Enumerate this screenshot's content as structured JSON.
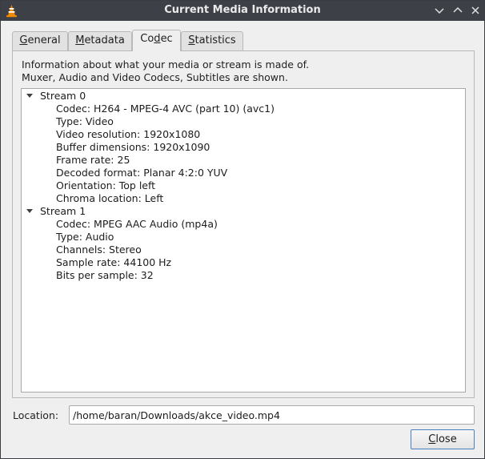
{
  "window": {
    "title": "Current Media Information"
  },
  "titlebar": {
    "icons": [
      "vlc-cone-icon",
      "minimize-icon",
      "maximize-icon",
      "close-icon"
    ]
  },
  "tabs": [
    {
      "label_pre": "",
      "label_ul": "G",
      "label_post": "eneral",
      "active": false
    },
    {
      "label_pre": "",
      "label_ul": "M",
      "label_post": "etadata",
      "active": false
    },
    {
      "label_pre": "Co",
      "label_ul": "d",
      "label_post": "ec",
      "active": true
    },
    {
      "label_pre": "",
      "label_ul": "S",
      "label_post": "tatistics",
      "active": false
    }
  ],
  "codec": {
    "description_line1": "Information about what your media or stream is made of.",
    "description_line2": "Muxer, Audio and Video Codecs, Subtitles are shown.",
    "streams": [
      {
        "label": "Stream 0",
        "properties": [
          "Codec: H264 - MPEG-4 AVC (part 10) (avc1)",
          "Type: Video",
          "Video resolution: 1920x1080",
          "Buffer dimensions: 1920x1090",
          "Frame rate: 25",
          "Decoded format: Planar 4:2:0 YUV",
          "Orientation: Top left",
          "Chroma location: Left"
        ]
      },
      {
        "label": "Stream 1",
        "properties": [
          "Codec: MPEG AAC Audio (mp4a)",
          "Type: Audio",
          "Channels: Stereo",
          "Sample rate: 44100 Hz",
          "Bits per sample: 32"
        ]
      }
    ]
  },
  "location": {
    "label": "Location:",
    "value": "/home/baran/Downloads/akce_video.mp4"
  },
  "buttons": {
    "close_ul": "C",
    "close_rest": "lose"
  },
  "colors": {
    "titlebar": "#3d4147",
    "window_bg": "#efefef",
    "focus_border": "#4a7fc1"
  }
}
